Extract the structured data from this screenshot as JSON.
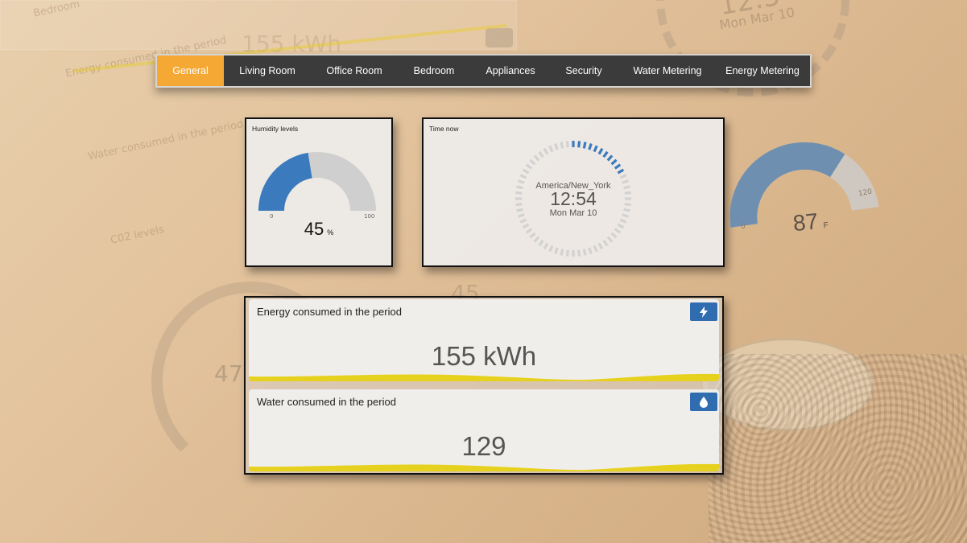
{
  "background": {
    "labels": [
      "Bedroom",
      "Energy consumed in the period",
      "Water consumed in the period",
      "C02 levels"
    ],
    "ghost_energy": "155 kWh",
    "ghost_clock_date": "Mon Mar 10",
    "ghost_clock_time": "12:5",
    "ghost_gauge_value": "47",
    "ghost_value_2": "45"
  },
  "tabs": [
    {
      "label": "General",
      "active": true
    },
    {
      "label": "Living Room",
      "active": false
    },
    {
      "label": "Office Room",
      "active": false
    },
    {
      "label": "Bedroom",
      "active": false
    },
    {
      "label": "Appliances",
      "active": false
    },
    {
      "label": "Security",
      "active": false
    },
    {
      "label": "Water Metering",
      "active": false
    },
    {
      "label": "Energy Metering",
      "active": false
    }
  ],
  "humidity": {
    "title": "Humidity levels",
    "value": "45",
    "unit": "%",
    "min": "0",
    "max": "100",
    "fraction": 0.45,
    "fill_color": "#3a7abd",
    "track_color": "#cfcfcf"
  },
  "clock": {
    "title": "Time now",
    "timezone": "America/New_York",
    "time": "12:54",
    "date": "Mon Mar 10",
    "seconds_fraction": 0.18,
    "accent_color": "#3a7abd"
  },
  "temperature": {
    "value": "87",
    "unit": "F",
    "min": "0",
    "max": "120",
    "fraction": 0.725,
    "fill_color": "#6f8fb0",
    "track_color": "#cfc8c0"
  },
  "energy": {
    "title": "Energy consumed in the period",
    "value": "155 kWh",
    "icon": "lightning-bolt-icon",
    "button_color": "#2f6db0",
    "wave_color": "#e6d21e"
  },
  "water": {
    "title": "Water consumed in the period",
    "value": "129",
    "icon": "water-drop-icon",
    "button_color": "#2f6db0",
    "wave_color": "#e6d21e"
  }
}
